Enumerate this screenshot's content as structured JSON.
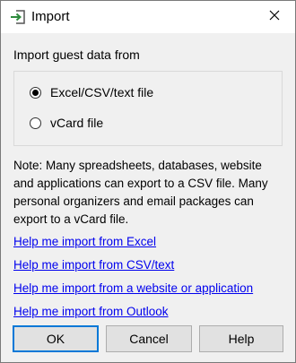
{
  "window": {
    "title": "Import",
    "icon": "import-arrow-icon",
    "close_icon": "close-icon"
  },
  "import_section": {
    "label": "Import guest data from",
    "options": [
      {
        "label": "Excel/CSV/text file",
        "selected": true
      },
      {
        "label": "vCard file",
        "selected": false
      }
    ]
  },
  "note": "Note: Many spreadsheets, databases, website and applications can export to a CSV file. Many personal organizers and email packages can export to a vCard file.",
  "links": [
    {
      "label": "Help me import from Excel"
    },
    {
      "label": "Help me import from CSV/text"
    },
    {
      "label": "Help me import from a website or application"
    },
    {
      "label": "Help me import from Outlook"
    }
  ],
  "buttons": {
    "ok": "OK",
    "cancel": "Cancel",
    "help": "Help"
  },
  "colors": {
    "link": "#0000ee",
    "default_button_border": "#0078d7",
    "icon_green": "#2e8b3d",
    "dialog_background": "#f0f0f0"
  }
}
